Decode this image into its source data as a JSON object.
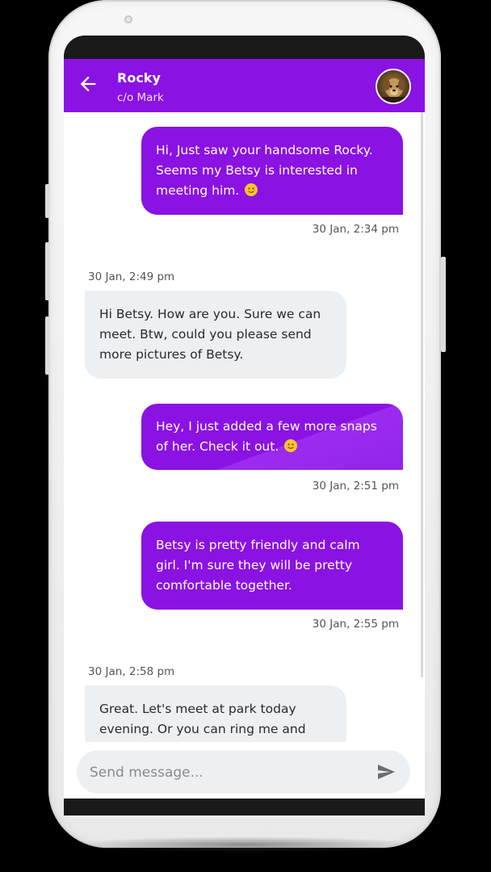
{
  "header": {
    "title": "Rocky",
    "subtitle": "c/o Mark"
  },
  "messages": [
    {
      "direction": "outgoing",
      "text": "Hi, Just saw your handsome Rocky.\nSeems my Betsy is interested in\nmeeting him.",
      "emoji": "smiling-face-emoji",
      "time": "30 Jan, 2:34 pm"
    },
    {
      "direction": "incoming",
      "time": "30 Jan, 2:49 pm",
      "text": "Hi Betsy. How are you. Sure we can\nmeet. Btw, could you please send\nmore pictures of Betsy."
    },
    {
      "direction": "outgoing",
      "text": "Hey, I just added a few more snaps\nof her. Check it out.",
      "emoji": "smiling-face-emoji",
      "time": "30 Jan, 2:51 pm"
    },
    {
      "direction": "outgoing",
      "text": "Betsy is pretty friendly and calm\ngirl. I'm sure they will be pretty\ncomfortable together.",
      "time": "30 Jan, 2:55 pm"
    },
    {
      "direction": "incoming",
      "time": "30 Jan, 2:58 pm",
      "text": "Great. Let's meet at park today\nevening. Or you can ring me and"
    }
  ],
  "composer": {
    "placeholder": "Send message...",
    "value": ""
  },
  "colors": {
    "accent": "#8a12e2",
    "incoming_bubble": "#edf0f2",
    "background": "#ffffff"
  },
  "icons": {
    "back": "arrow-left-icon",
    "send": "send-icon",
    "avatar": "dog-avatar"
  }
}
